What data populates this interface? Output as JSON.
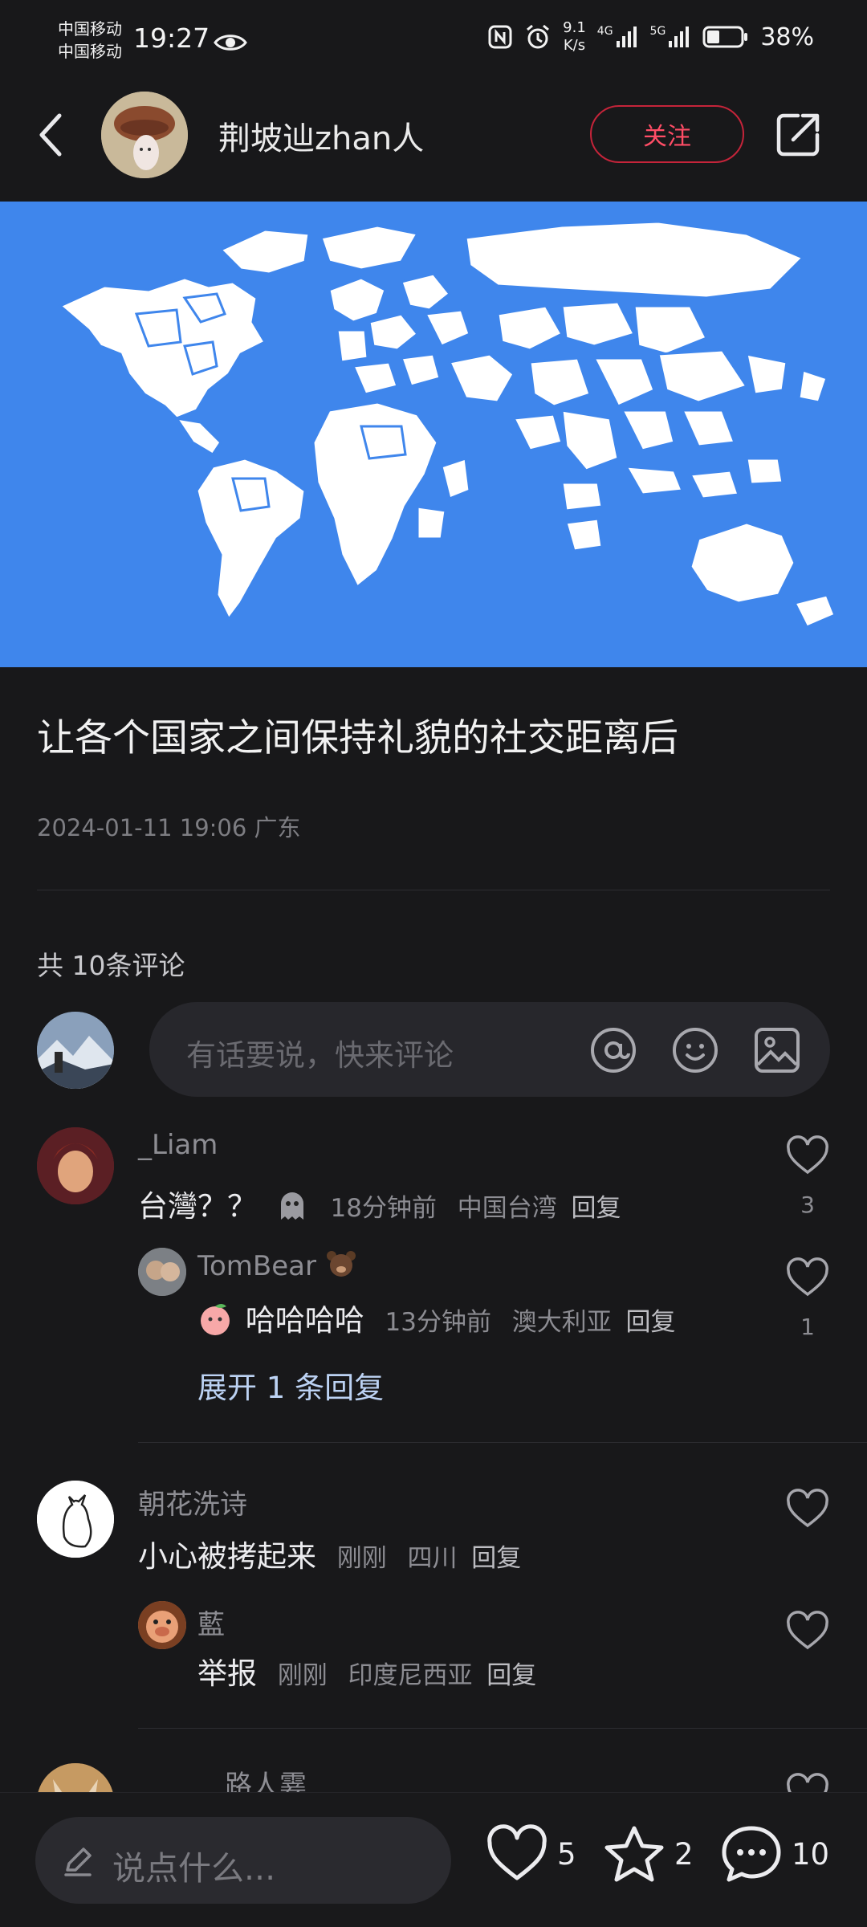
{
  "status_bar": {
    "carrier1": "中国移动",
    "carrier2": "中国移动",
    "time": "19:27",
    "net_speed_value": "9.1",
    "net_speed_unit": "K/s",
    "net1": "4G",
    "net2": "5G",
    "battery": "38%",
    "battery_level": 0.38
  },
  "header": {
    "author": "荆坡辿zhan人",
    "follow_label": "关注"
  },
  "post": {
    "title": "让各个国家之间保持礼貌的社交距离后",
    "meta": "2024-01-11 19:06 广东",
    "comment_count": "共 10条评论"
  },
  "comment_input": {
    "placeholder": "有话要说，快来评论"
  },
  "comments": [
    {
      "user": "_Liam",
      "text": "台灣？？",
      "time": "18分钟前",
      "location": "中国台湾",
      "reply": "回复",
      "likes": "3"
    },
    {
      "user": "TomBear",
      "text": "哈哈哈哈",
      "time": "13分钟前",
      "location": "澳大利亚",
      "reply": "回复",
      "likes": "1"
    },
    {
      "expand": "展开 1 条回复"
    },
    {
      "user": "朝花洗诗",
      "text": "小心被拷起来",
      "time": "刚刚",
      "location": "四川",
      "reply": "回复"
    },
    {
      "user": "藍",
      "text": "举报",
      "time": "刚刚",
      "location": "印度尼西亚",
      "reply": "回复"
    },
    {
      "user": "路人霎"
    }
  ],
  "bottom_bar": {
    "say_placeholder": "说点什么...",
    "like_count": "5",
    "star_count": "2",
    "comment_count": "10"
  },
  "colors": {
    "background": "#18181a",
    "map_ocean": "#3f86ec",
    "follow_border": "#c5243a"
  }
}
